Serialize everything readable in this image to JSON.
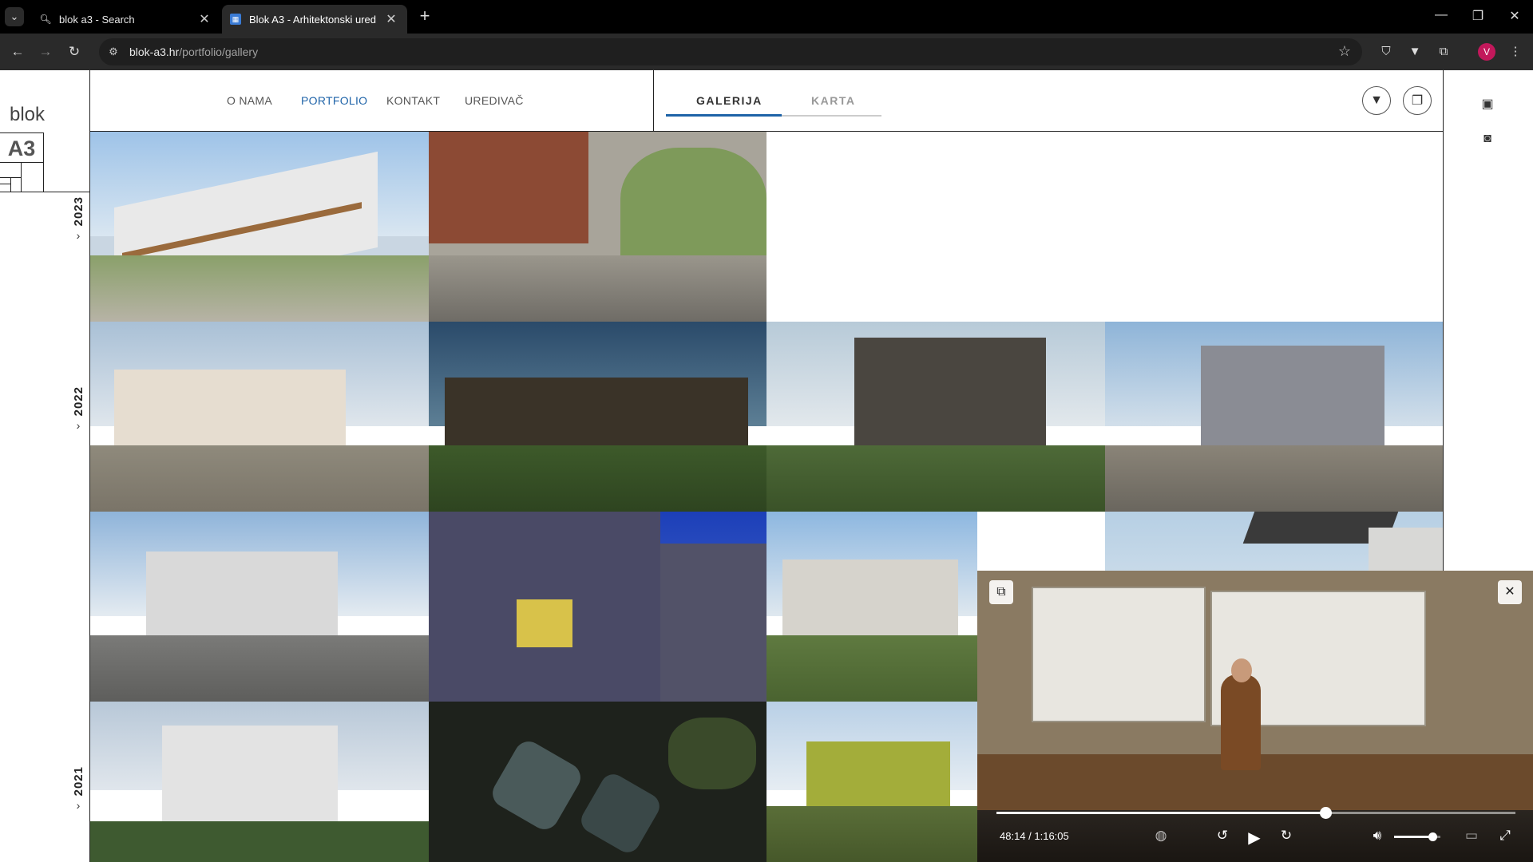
{
  "browser": {
    "tabs": [
      {
        "title": "blok a3 - Search",
        "favicon": "search-icon",
        "active": false
      },
      {
        "title": "Blok A3 - Arhitektonski ured",
        "favicon": "site-favicon",
        "active": true
      }
    ],
    "url_host": "blok-a3.hr",
    "url_path": "/portfolio/gallery",
    "avatar_initial": "V"
  },
  "site": {
    "logo_text": "blok",
    "logo_mark": "A3",
    "menu": [
      {
        "label": "O NAMA",
        "active": false
      },
      {
        "label": "PORTFOLIO",
        "active": true
      },
      {
        "label": "KONTAKT",
        "active": false
      },
      {
        "label": "UREDIVAČ",
        "active": false
      }
    ],
    "view_tabs": [
      {
        "label": "GALERIJA",
        "active": true
      },
      {
        "label": "KARTA",
        "active": false
      }
    ],
    "years": [
      "2023",
      "2022",
      "2021"
    ],
    "accent_color": "#1e63a8"
  },
  "video": {
    "time": "48:14 / 1:16:05",
    "progress_fraction": 0.634,
    "volume_fraction": 0.82
  }
}
